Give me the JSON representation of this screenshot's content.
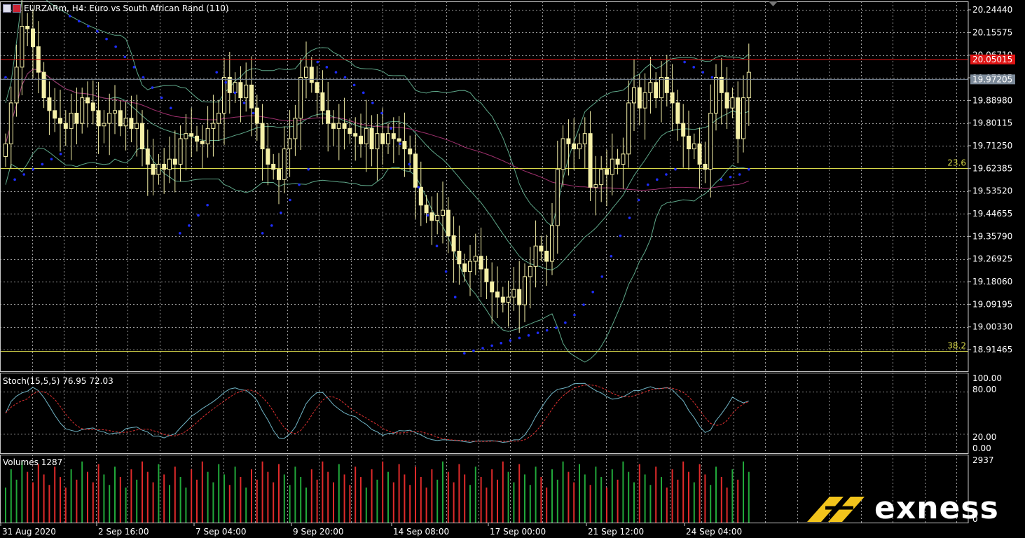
{
  "window": {
    "title": "EURZARm, H4: Euro vs South African Rand (110)"
  },
  "colors": {
    "background": "#000000",
    "grid": "#d8d8d8",
    "candle": "#f5f0a8",
    "sar_dots": "#1e2dff",
    "bollinger": "#5fa88a",
    "ma_line": "#a0306e",
    "fib_line": "#d8d84a",
    "price_marker_red": "#e01616",
    "price_marker_gray": "#7c8a99",
    "stoch_main": "#6fb3c4",
    "stoch_signal": "#e03030",
    "volume_up": "#21a83a",
    "volume_down": "#e02a2a"
  },
  "price_axis": {
    "ticks": [
      "20.24440",
      "20.15575",
      "20.06710",
      "19.97205",
      "19.88980",
      "19.80115",
      "19.71250",
      "19.62385",
      "19.53520",
      "19.44655",
      "19.35790",
      "19.26925",
      "19.18060",
      "19.09195",
      "19.00330",
      "18.91465"
    ],
    "marker_red": "20.05015",
    "marker_gray": "19.97205"
  },
  "fibonacci": [
    {
      "label": "23.6"
    },
    {
      "label": "38.2"
    }
  ],
  "time_axis": {
    "labels": [
      "31 Aug 2020",
      "2 Sep 16:00",
      "7 Sep 04:00",
      "9 Sep 20:00",
      "14 Sep 08:00",
      "17 Sep 00:00",
      "21 Sep 12:00",
      "24 Sep 04:00"
    ]
  },
  "stochastic": {
    "label": "Stoch(15,5,5) 76.95 72.03",
    "ticks": [
      "100.00",
      "80.00",
      "20.00",
      "0.00"
    ]
  },
  "volumes": {
    "label": "Volumes 1287",
    "ticks": [
      "2937",
      "0"
    ]
  },
  "brand": {
    "name": "exness"
  },
  "chart_data": {
    "type": "candlestick",
    "symbol": "EURZARm",
    "timeframe": "H4",
    "ylim": [
      18.87,
      20.27
    ],
    "closes": [
      19.72,
      19.88,
      20.02,
      20.18,
      20.17,
      20.1,
      20.0,
      19.9,
      19.85,
      19.82,
      19.8,
      19.78,
      19.84,
      19.8,
      19.9,
      19.88,
      19.85,
      19.79,
      19.8,
      19.84,
      19.85,
      19.79,
      19.82,
      19.78,
      19.8,
      19.7,
      19.64,
      19.6,
      19.64,
      19.62,
      19.66,
      19.64,
      19.74,
      19.76,
      19.75,
      19.73,
      19.72,
      19.78,
      19.8,
      19.84,
      19.98,
      19.92,
      19.96,
      19.9,
      19.95,
      19.86,
      19.8,
      19.7,
      19.64,
      19.62,
      19.58,
      19.7,
      19.74,
      19.82,
      19.98,
      20.02,
      19.96,
      19.92,
      19.85,
      19.8,
      19.78,
      19.8,
      19.78,
      19.76,
      19.75,
      19.72,
      19.78,
      19.7,
      19.76,
      19.72,
      19.76,
      19.74,
      19.73,
      19.7,
      19.68,
      19.55,
      19.48,
      19.45,
      19.42,
      19.44,
      19.46,
      19.36,
      19.3,
      19.25,
      19.22,
      19.26,
      19.28,
      19.23,
      19.18,
      19.14,
      19.12,
      19.1,
      19.12,
      19.15,
      19.09,
      19.2,
      19.24,
      19.32,
      19.3,
      19.26,
      19.4,
      19.62,
      19.74,
      19.72,
      19.7,
      19.72,
      19.76,
      19.55,
      19.56,
      19.62,
      19.6,
      19.66,
      19.64,
      19.68,
      19.88,
      19.94,
      19.86,
      19.92,
      19.96,
      19.9,
      19.98,
      19.92,
      19.88,
      19.8,
      19.75,
      19.7,
      19.72,
      19.64,
      19.62,
      19.84,
      19.98,
      19.92,
      19.86,
      19.9,
      19.74,
      19.9,
      20.0
    ],
    "sar": [
      19.98,
      19.58,
      19.6,
      19.62,
      19.64,
      19.66,
      19.68,
      20.22,
      20.2,
      20.18,
      20.16,
      20.13,
      20.1,
      20.06,
      20.02,
      19.98,
      19.94,
      19.9,
      19.86,
      19.37,
      19.4,
      19.44,
      19.48,
      20.0,
      19.96,
      19.92,
      19.88,
      19.84,
      19.37,
      19.4,
      19.45,
      19.5,
      19.56,
      19.62,
      20.04,
      20.02,
      20.0,
      19.98,
      19.95,
      19.92,
      19.88,
      19.84,
      19.78,
      19.72,
      19.64,
      19.55,
      19.44,
      19.32,
      19.22,
      19.12,
      18.9,
      18.91,
      18.92,
      18.93,
      18.94,
      18.95,
      18.96,
      18.97,
      18.98,
      18.99,
      19.0,
      19.02,
      19.05,
      19.09,
      19.14,
      19.2,
      19.28,
      19.36,
      19.43,
      19.5,
      19.56,
      19.58,
      19.6,
      19.62,
      20.04,
      20.02,
      20.0,
      19.98,
      19.58,
      19.59,
      19.6,
      19.62
    ]
  }
}
